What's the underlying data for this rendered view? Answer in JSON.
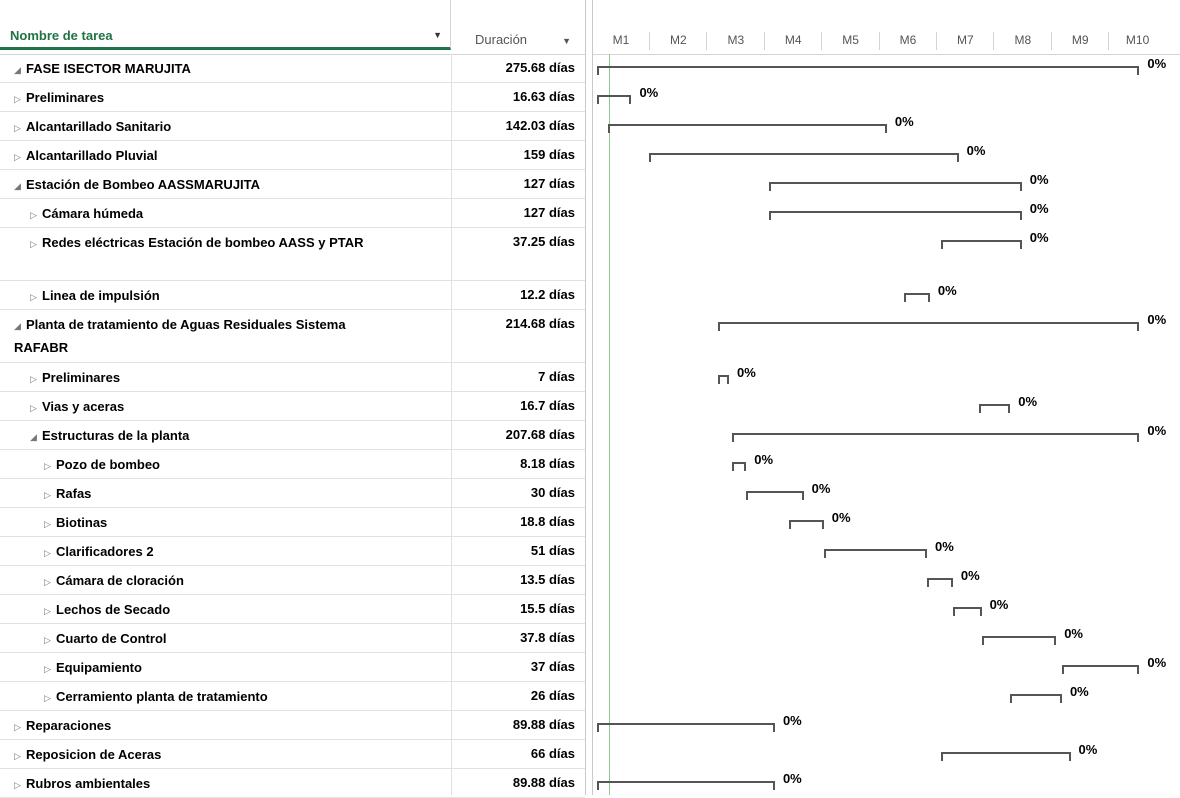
{
  "columns": {
    "name": "Nombre de tarea",
    "duration": "Duración"
  },
  "months": [
    "M1",
    "M2",
    "M3",
    "M4",
    "M5",
    "M6",
    "M7",
    "M8",
    "M9",
    "M10"
  ],
  "tasks": [
    {
      "name": "FASE ISECTOR MARUJITA",
      "duration": "275.68 días",
      "level": 0,
      "toggle": "◢",
      "pct": "0%",
      "start": 0.0,
      "end": 9.45
    },
    {
      "name": "Preliminares",
      "duration": "16.63 días",
      "level": 1,
      "toggle": "▷",
      "pct": "0%",
      "start": 0.0,
      "end": 0.6
    },
    {
      "name": "Alcantarillado Sanitario",
      "duration": "142.03 días",
      "level": 1,
      "toggle": "▷",
      "pct": "0%",
      "start": 0.2,
      "end": 5.05
    },
    {
      "name": "Alcantarillado Pluvial",
      "duration": "159 días",
      "level": 1,
      "toggle": "▷",
      "pct": "0%",
      "start": 0.9,
      "end": 6.3
    },
    {
      "name": "Estación de Bombeo AASSMARUJITA",
      "duration": "127 días",
      "level": 1,
      "toggle": "◢",
      "pct": "0%",
      "start": 3.0,
      "end": 7.4
    },
    {
      "name": "Cámara húmeda",
      "duration": "127 días",
      "level": 2,
      "toggle": "▷",
      "pct": "0%",
      "start": 3.0,
      "end": 7.4
    },
    {
      "name": "Redes eléctricas Estación de bombeo AASS y PTAR",
      "duration": "37.25 días",
      "level": 2,
      "toggle": "▷",
      "pct": "0%",
      "start": 6.0,
      "end": 7.4
    },
    {
      "name": "Linea de impulsión",
      "duration": "12.2 días",
      "level": 2,
      "toggle": "▷",
      "pct": "0%",
      "start": 5.35,
      "end": 5.8
    },
    {
      "name": "Planta de tratamiento de Aguas Residuales Sistema RAFABR",
      "duration": "214.68 días",
      "level": 1,
      "toggle": "◢",
      "pct": "0%",
      "start": 2.1,
      "end": 9.45
    },
    {
      "name": "Preliminares",
      "duration": "7 días",
      "level": 2,
      "toggle": "▷",
      "pct": "0%",
      "start": 2.1,
      "end": 2.3
    },
    {
      "name": "Vias y aceras",
      "duration": "16.7 días",
      "level": 2,
      "toggle": "▷",
      "pct": "0%",
      "start": 6.65,
      "end": 7.2
    },
    {
      "name": "Estructuras de la planta",
      "duration": "207.68 días",
      "level": 2,
      "toggle": "◢",
      "pct": "0%",
      "start": 2.35,
      "end": 9.45
    },
    {
      "name": "Pozo de bombeo",
      "duration": "8.18 días",
      "level": 3,
      "toggle": "▷",
      "pct": "0%",
      "start": 2.35,
      "end": 2.6
    },
    {
      "name": "Rafas",
      "duration": "30 días",
      "level": 3,
      "toggle": "▷",
      "pct": "0%",
      "start": 2.6,
      "end": 3.6
    },
    {
      "name": "Biotinas",
      "duration": "18.8 días",
      "level": 3,
      "toggle": "▷",
      "pct": "0%",
      "start": 3.35,
      "end": 3.95
    },
    {
      "name": "Clarificadores 2",
      "duration": "51 días",
      "level": 3,
      "toggle": "▷",
      "pct": "0%",
      "start": 3.95,
      "end": 5.75
    },
    {
      "name": "Cámara de cloración",
      "duration": "13.5 días",
      "level": 3,
      "toggle": "▷",
      "pct": "0%",
      "start": 5.75,
      "end": 6.2
    },
    {
      "name": "Lechos de Secado",
      "duration": "15.5 días",
      "level": 3,
      "toggle": "▷",
      "pct": "0%",
      "start": 6.2,
      "end": 6.7
    },
    {
      "name": "Cuarto de Control",
      "duration": "37.8 días",
      "level": 3,
      "toggle": "▷",
      "pct": "0%",
      "start": 6.7,
      "end": 8.0
    },
    {
      "name": "Equipamiento",
      "duration": "37 días",
      "level": 3,
      "toggle": "▷",
      "pct": "0%",
      "start": 8.1,
      "end": 9.45
    },
    {
      "name": "Cerramiento planta de tratamiento",
      "duration": "26 días",
      "level": 3,
      "toggle": "▷",
      "pct": "0%",
      "start": 7.2,
      "end": 8.1
    },
    {
      "name": "Reparaciones",
      "duration": "89.88 días",
      "level": 1,
      "toggle": "▷",
      "pct": "0%",
      "start": 0.0,
      "end": 3.1
    },
    {
      "name": "Reposicion de Aceras",
      "duration": "66 días",
      "level": 1,
      "toggle": "▷",
      "pct": "0%",
      "start": 6.0,
      "end": 8.25
    },
    {
      "name": "Rubros ambientales",
      "duration": "89.88 días",
      "level": 1,
      "toggle": "▷",
      "pct": "0%",
      "start": 0.0,
      "end": 3.1
    }
  ]
}
